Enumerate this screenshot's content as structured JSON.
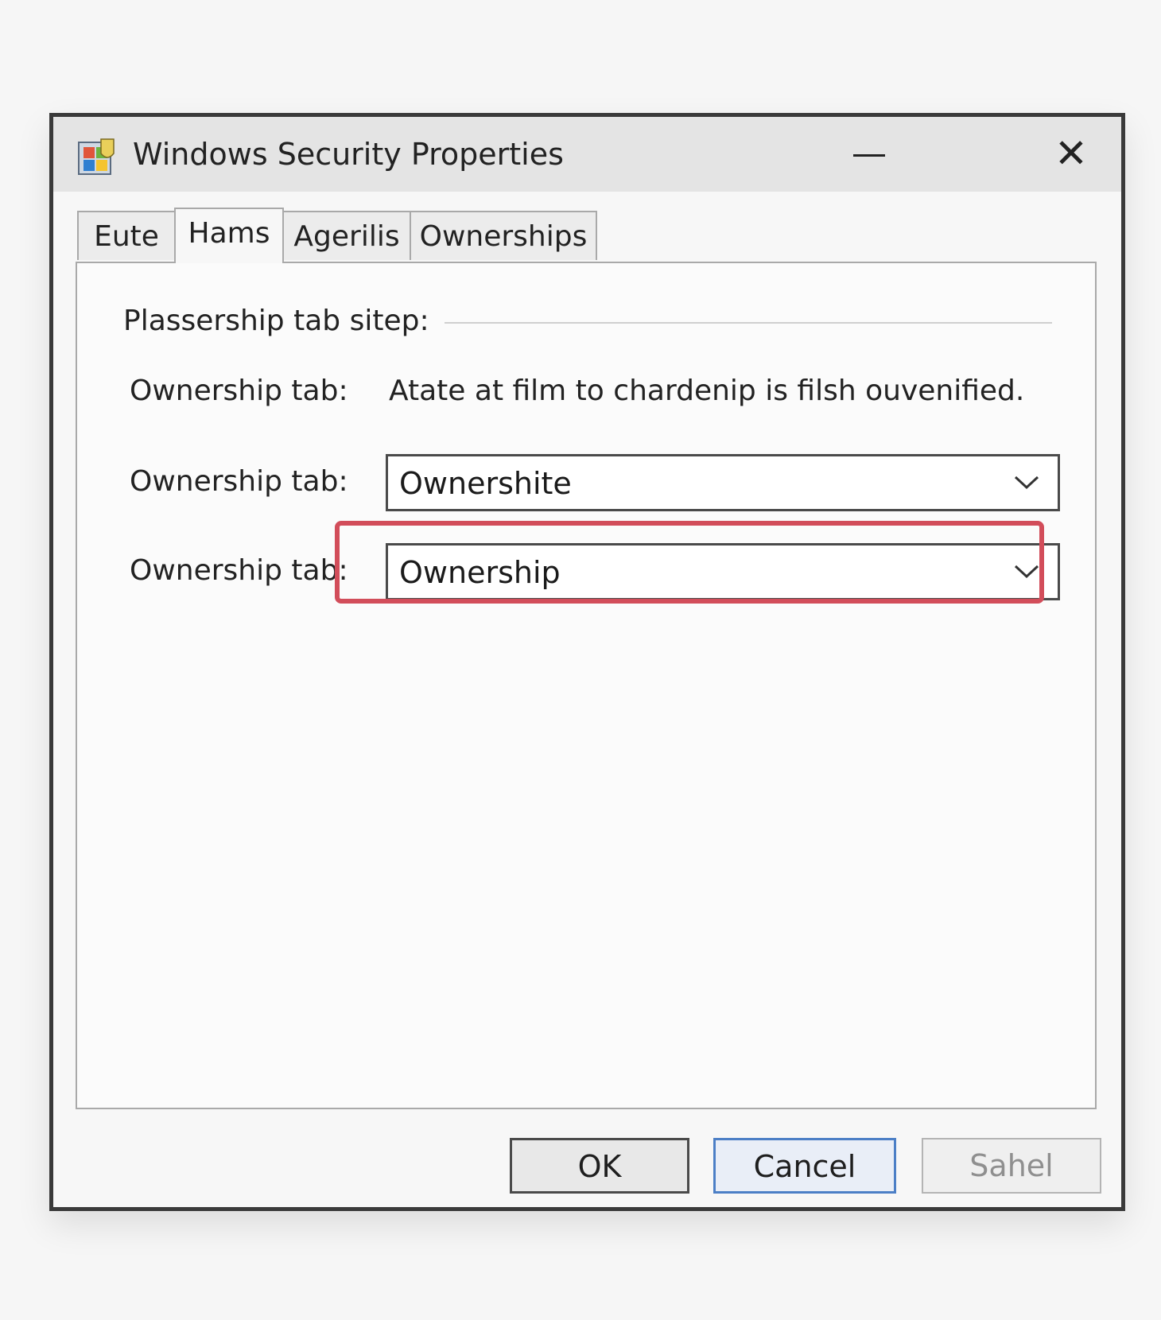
{
  "window": {
    "title": "Windows Security Properties",
    "icon": "windows-security-icon",
    "minimize_icon": "minimize-icon",
    "close_icon": "close-icon",
    "close_glyph": "✕"
  },
  "tabs": [
    {
      "label": "Eute",
      "active": false
    },
    {
      "label": "Hams",
      "active": true
    },
    {
      "label": "Agerilis",
      "active": false
    },
    {
      "label": "Ownerships",
      "active": false
    }
  ],
  "panel": {
    "group_title": "Plassership tab sitep:",
    "rows": [
      {
        "label": "Ownership tab:",
        "value": "Atate at film to chardenip is filsh ouvenified."
      },
      {
        "label": "Ownership tab:",
        "selected": "Ownershite"
      },
      {
        "label": "Ownership tab:",
        "selected": "Ownership"
      }
    ],
    "highlight_color": "#d24d5a"
  },
  "buttons": {
    "ok": "OK",
    "cancel": "Cancel",
    "apply": "Sahel"
  }
}
